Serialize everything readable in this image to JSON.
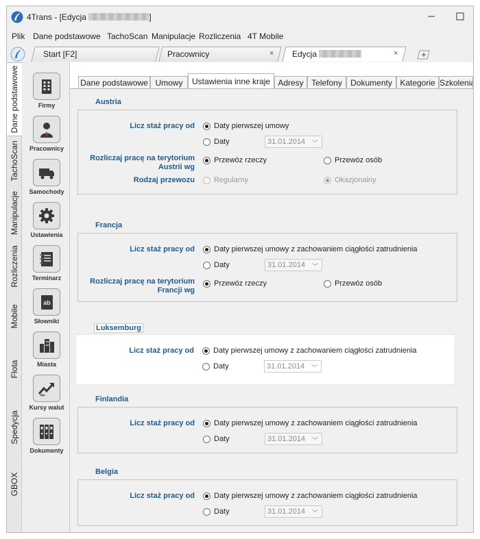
{
  "window": {
    "title_prefix": "4Trans - [Edycja",
    "title_suffix": "]"
  },
  "menu": [
    "Plik",
    "Dane podstawowe",
    "TachoScan",
    "Manipulacje",
    "Rozliczenia",
    "4T Mobile"
  ],
  "doc_tabs": [
    {
      "label": "Start [F2]",
      "closable": false
    },
    {
      "label": "Pracownicy",
      "closable": true
    },
    {
      "label": "Edycja",
      "closable": true
    }
  ],
  "tab_close_glyph": "×",
  "vertical_tabs": [
    "Dane podstawowe",
    "TachoScan",
    "Manipulacje",
    "Rozliczenia",
    "Mobile",
    "Flota",
    "Spedycja",
    "GBOX"
  ],
  "tiles": [
    {
      "label": "Firmy",
      "icon": "building-icon"
    },
    {
      "label": "Pracownicy",
      "icon": "person-icon"
    },
    {
      "label": "Samochody",
      "icon": "truck-icon"
    },
    {
      "label": "Ustawienia",
      "icon": "gear-icon"
    },
    {
      "label": "Terminarz",
      "icon": "notebook-icon"
    },
    {
      "label": "Słowniki",
      "icon": "dictionary-icon"
    },
    {
      "label": "Miasta",
      "icon": "city-icon"
    },
    {
      "label": "Kursy walut",
      "icon": "chart-arrow-icon"
    },
    {
      "label": "Dokumenty",
      "icon": "binders-icon"
    }
  ],
  "subtabs": [
    "Dane podstawowe",
    "Umowy",
    "Ustawienia inne kraje",
    "Adresy",
    "Telefony",
    "Dokumenty",
    "Kategorie",
    "Szkolenia"
  ],
  "labels": {
    "staz": "Licz staż pracy od",
    "rozlicz_austria_1": "Rozliczaj pracę na terytorium",
    "rozlicz_austria_2": "Austrii wg",
    "rodzaj": "Rodzaj przewozu",
    "rozlicz_francja_1": "Rozliczaj pracę na terytorium",
    "rozlicz_francja_2": "Francji wg"
  },
  "options": {
    "pierwszej_umowy": "Daty pierwszej umowy",
    "pierwszej_umowy_ciaglosc": "Daty pierwszej umowy z zachowaniem ciągłości zatrudnienia",
    "daty": "Daty",
    "przewoz_rzeczy": "Przewóz rzeczy",
    "przewoz_osob": "Przewóz osób",
    "regularny": "Regularny",
    "okazjonalny": "Okazjonalny"
  },
  "date_value": "31.01.2014",
  "sections": {
    "austria": "Austria",
    "francja": "Francja",
    "luksemburg": "Luksemburg",
    "finlandia": "Finlandia",
    "belgia": "Belgia"
  }
}
